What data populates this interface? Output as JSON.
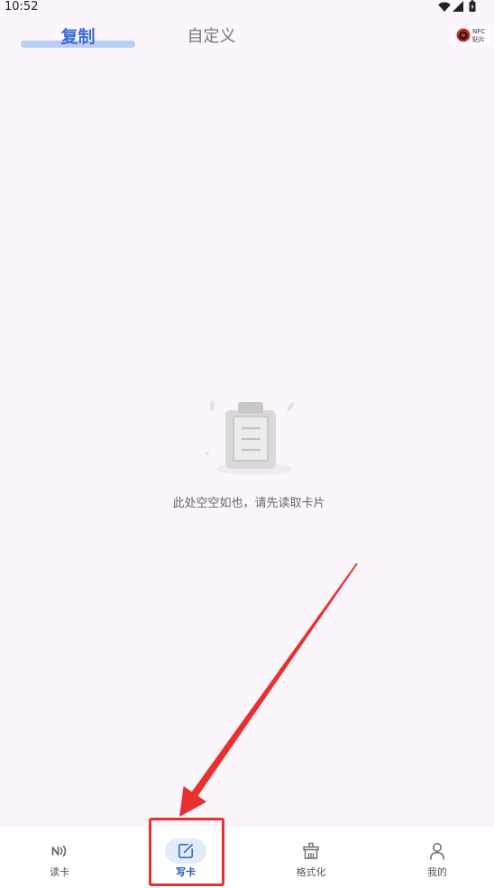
{
  "status_bar": {
    "time": "10:52",
    "icons": [
      "wifi-icon",
      "signal-icon",
      "battery-icon"
    ]
  },
  "header": {
    "tabs": [
      {
        "label": "复制",
        "active": true
      },
      {
        "label": "自定义",
        "active": false
      }
    ],
    "logo": {
      "icon": "nfc-sticker-logo",
      "line1": "NFC",
      "line2": "贴片"
    }
  },
  "empty_state": {
    "icon": "empty-clipboard-icon",
    "message": "此处空空如也，请先读取卡片"
  },
  "bottom_nav": {
    "items": [
      {
        "label": "读卡",
        "icon": "nfc-read-icon",
        "active": false
      },
      {
        "label": "写卡",
        "icon": "edit-icon",
        "active": true
      },
      {
        "label": "格式化",
        "icon": "format-basket-icon",
        "active": false
      },
      {
        "label": "我的",
        "icon": "person-icon",
        "active": false
      }
    ]
  },
  "colors": {
    "accent": "#3a6ad4",
    "accent_dark": "#2b57c0",
    "background": "#fcf5fc",
    "tab_indicator": "#bccdf3",
    "active_pill": "#e3eaf8",
    "muted_text": "#777777",
    "annotation_red": "#e8312f"
  }
}
